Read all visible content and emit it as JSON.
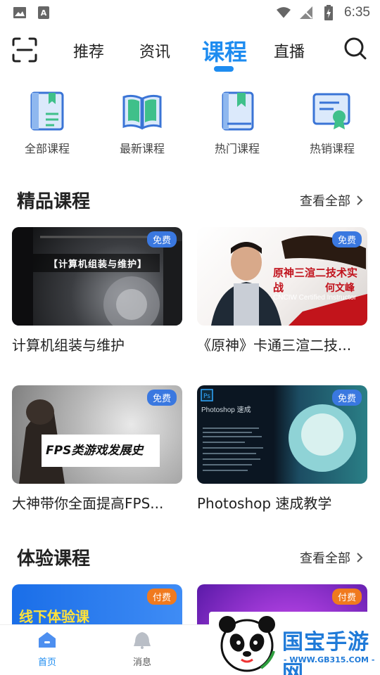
{
  "status_bar": {
    "time": "6:35"
  },
  "top_nav": {
    "tabs": [
      {
        "label": "推荐",
        "active": false
      },
      {
        "label": "资讯",
        "active": false
      },
      {
        "label": "课程",
        "active": true
      },
      {
        "label": "直播",
        "active": false
      }
    ]
  },
  "categories": [
    {
      "label": "全部课程",
      "icon": "book-bookmark-icon"
    },
    {
      "label": "最新课程",
      "icon": "open-book-icon"
    },
    {
      "label": "热门课程",
      "icon": "bookmark-book-icon"
    },
    {
      "label": "热销课程",
      "icon": "certificate-icon"
    }
  ],
  "featured": {
    "title": "精品课程",
    "more_label": "查看全部",
    "courses": [
      {
        "title": "计算机组装与维护",
        "badge": "免费",
        "thumb_text": "【计算机组装与维护】"
      },
      {
        "title": "《原神》卡通三渲二技...",
        "badge": "免费",
        "thumb_text": "原神三渲二技术实战",
        "thumb_sub": "CNCIW Certified Instructor",
        "thumb_name": "何文峰"
      },
      {
        "title": "大神带你全面提高FPS...",
        "badge": "免费",
        "thumb_text": "FPS类游戏发展史"
      },
      {
        "title": "Photoshop 速成教学",
        "badge": "免费",
        "thumb_text": "Photoshop 速成"
      }
    ]
  },
  "trial": {
    "title": "体验课程",
    "more_label": "查看全部",
    "courses": [
      {
        "badge": "付费",
        "thumb_text": "线下体验课"
      },
      {
        "badge": "付费"
      }
    ]
  },
  "bottom_nav": {
    "items": [
      {
        "label": "首页",
        "active": true
      },
      {
        "label": "消息",
        "active": false
      }
    ]
  },
  "watermark": {
    "text": "国宝手游网",
    "sub": "- WWW.GB315.COM -"
  },
  "colors": {
    "accent": "#1e8cf0",
    "free_badge": "#3a78e0",
    "paid_badge": "#f07a1e"
  }
}
